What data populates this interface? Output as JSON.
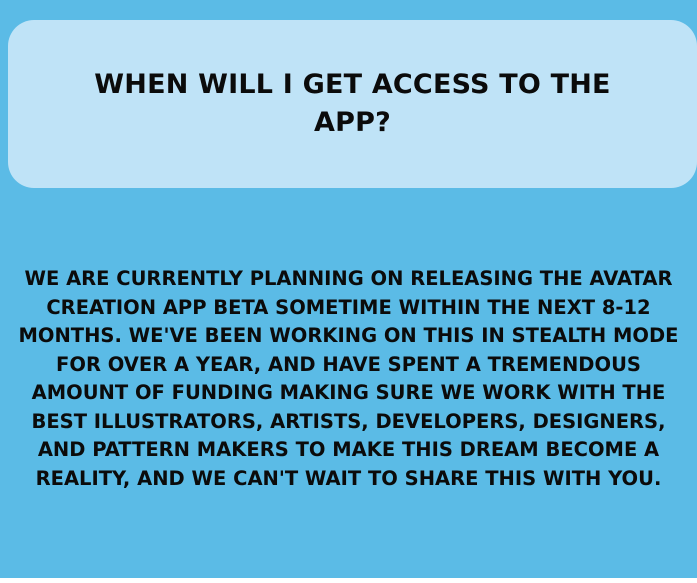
{
  "header": {
    "title": "WHEN WILL I GET ACCESS TO THE APP?"
  },
  "content": {
    "paragraph": "WE ARE CURRENTLY PLANNING ON RELEASING THE AVATAR CREATION APP BETA SOMETIME WITHIN THE NEXT 8-12 MONTHS. WE'VE BEEN WORKING ON THIS IN STEALTH MODE FOR OVER A YEAR, AND HAVE SPENT A TREMENDOUS AMOUNT OF FUNDING MAKING SURE WE WORK WITH THE BEST ILLUSTRATORS, ARTISTS, DEVELOPERS, DESIGNERS, AND PATTERN MAKERS TO MAKE THIS DREAM BECOME A REALITY, AND WE CAN'T WAIT TO SHARE THIS WITH YOU."
  },
  "colors": {
    "panel_background": "#5bbbe6",
    "header_card_background": "#bfe3f7",
    "text": "#0b0b0b"
  }
}
